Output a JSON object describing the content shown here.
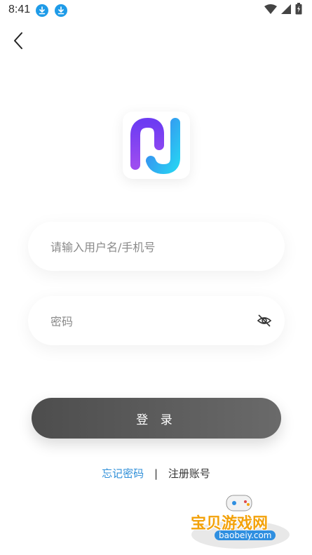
{
  "status_bar": {
    "time": "8:41",
    "left_icons": [
      "download-icon",
      "download-icon"
    ],
    "right_icons": [
      "wifi-icon",
      "signal-icon",
      "battery-icon"
    ]
  },
  "nav": {
    "back_icon": "chevron-left-icon"
  },
  "logo": {
    "icon": "app-logo-icon",
    "colors": [
      "#7a3cf0",
      "#2fc8f0"
    ]
  },
  "form": {
    "username": {
      "value": "",
      "placeholder": "请输入用户名/手机号"
    },
    "password": {
      "value": "",
      "placeholder": "密码",
      "toggle_icon": "eye-off-icon"
    },
    "login_label": "登 录"
  },
  "links": {
    "forgot_password": "忘记密码",
    "separator": "|",
    "register": "注册账号"
  },
  "watermark": {
    "title": "宝贝游戏网",
    "url": "baobeiy.com"
  },
  "colors": {
    "accent_link": "#2f8fd8",
    "button": "#555555",
    "download_icon": "#1e9be8"
  }
}
